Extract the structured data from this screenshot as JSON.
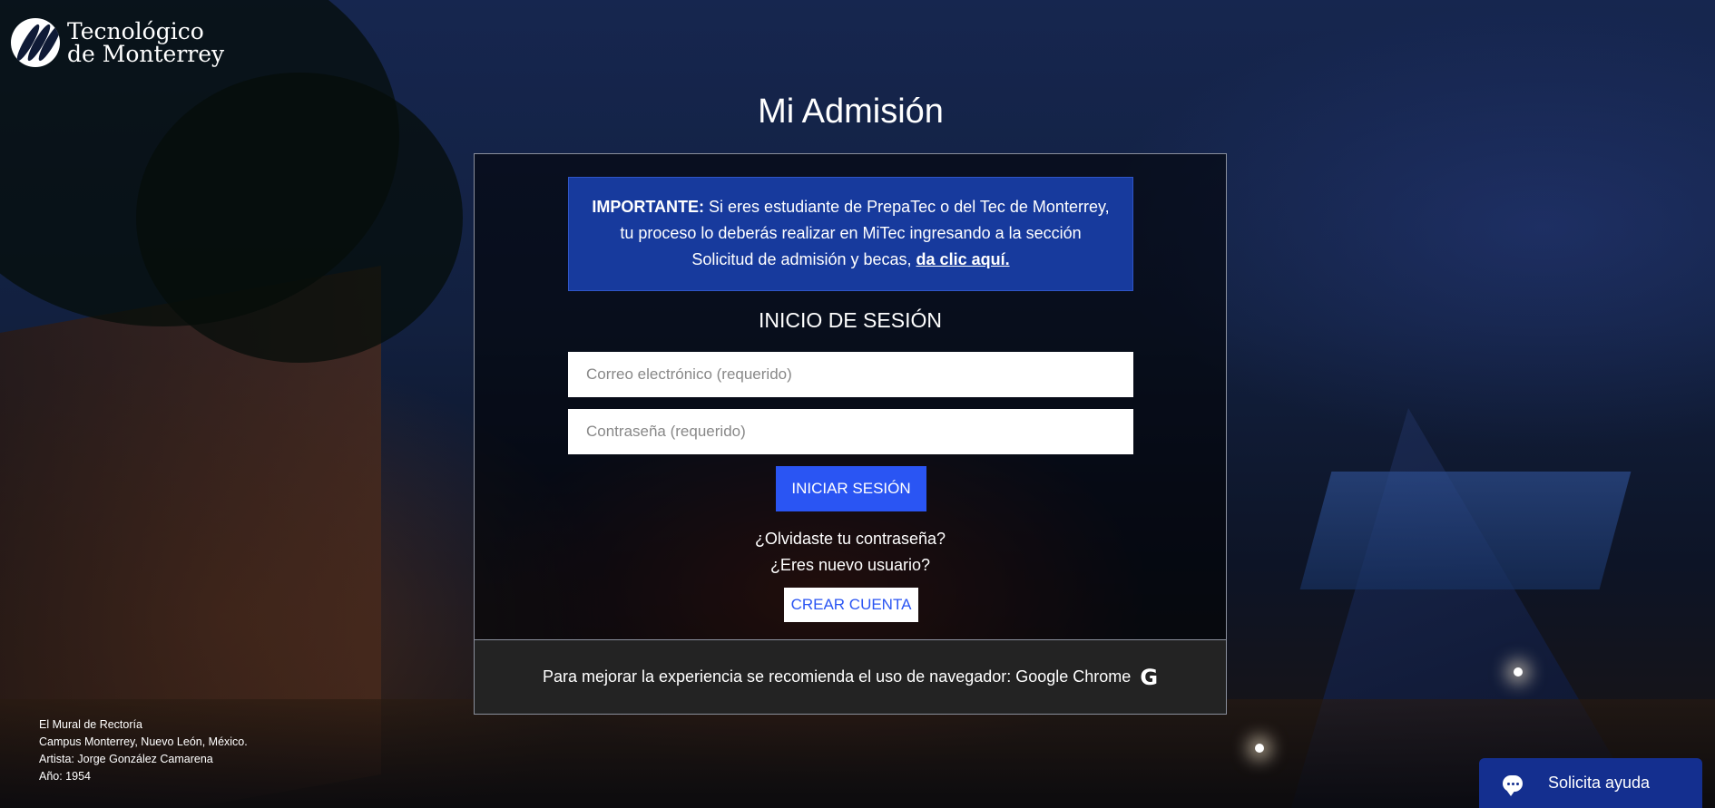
{
  "brand": {
    "line1": "Tecnológico",
    "line2": "de Monterrey"
  },
  "page": {
    "title": "Mi Admisión"
  },
  "notice": {
    "label": "IMPORTANTE:",
    "text": "Si eres estudiante de PrepaTec o del Tec de Monterrey, tu proceso lo deberás realizar en MiTec ingresando a la sección Solicitud de admisión y becas,",
    "link": "da clic aquí."
  },
  "login": {
    "heading": "INICIO DE SESIÓN",
    "email_placeholder": "Correo electrónico (requerido)",
    "password_placeholder": "Contraseña (requerido)",
    "submit": "INICIAR SESIÓN",
    "forgot": "¿Olvidaste tu contraseña?",
    "new_user": "¿Eres nuevo usuario?",
    "create": "CREAR CUENTA"
  },
  "footer": {
    "text": "Para mejorar la experiencia se recomienda el uso de navegador: Google Chrome",
    "icon": "google-icon",
    "glyph": "G"
  },
  "credits": {
    "line1": "El Mural de Rectoría",
    "line2": "Campus Monterrey, Nuevo León, México.",
    "line3": "Artista: Jorge González Camarena",
    "line4": "Año: 1954"
  },
  "help": {
    "label": "Solicita ayuda",
    "icon": "chat-icon"
  },
  "colors": {
    "accent": "#2a55f3",
    "notice_bg": "#173a9d",
    "help_bg": "#142f8f"
  }
}
